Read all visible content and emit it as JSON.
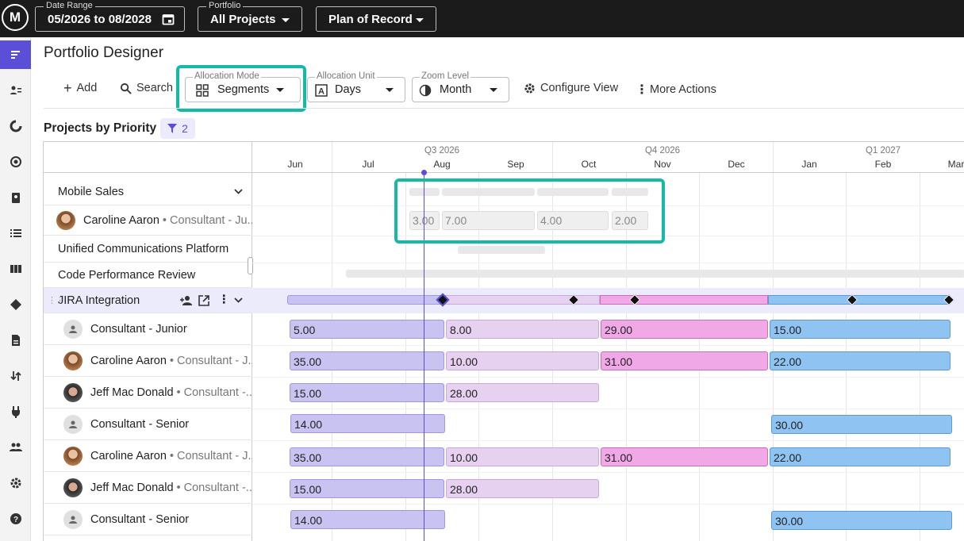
{
  "topbar": {
    "logo": "M",
    "date_range": {
      "label": "Date Range",
      "value": "05/2026 to 08/2028"
    },
    "portfolio": {
      "label": "Portfolio",
      "value": "All Projects"
    },
    "plan": {
      "value": "Plan of Record"
    }
  },
  "page": {
    "title": "Portfolio Designer"
  },
  "toolbar": {
    "add_label": "Add",
    "search_label": "Search",
    "allocation_mode": {
      "label": "Allocation Mode",
      "value": "Segments"
    },
    "allocation_unit": {
      "label": "Allocation Unit",
      "value": "Days"
    },
    "zoom_level": {
      "label": "Zoom Level",
      "value": "Month"
    },
    "configure_label": "Configure View",
    "more_label": "More Actions"
  },
  "section": {
    "title": "Projects by Priority",
    "filter_count": "2"
  },
  "timeline": {
    "quarters": [
      "Q3 2026",
      "Q4 2026",
      "Q1 2027"
    ],
    "months": [
      "Jun",
      "Jul",
      "Aug",
      "Sep",
      "Oct",
      "Nov",
      "Dec",
      "Jan",
      "Feb",
      "Mar"
    ]
  },
  "rows": [
    {
      "name": "Mobile Sales"
    },
    {
      "name": "Caroline Aaron",
      "role": "• Consultant - Ju..."
    },
    {
      "name": "Unified Communications Platform"
    },
    {
      "name": "Code Performance Review"
    },
    {
      "name": "JIRA Integration"
    },
    {
      "name": "Consultant - Junior"
    },
    {
      "name": "Caroline Aaron",
      "role": "• Consultant - J..."
    },
    {
      "name": "Jeff Mac Donald",
      "role": "• Consultant -..."
    },
    {
      "name": "Consultant - Senior"
    },
    {
      "name": "Caroline Aaron",
      "role": "• Consultant - J..."
    },
    {
      "name": "Jeff Mac Donald",
      "role": "• Consultant -..."
    },
    {
      "name": "Consultant - Senior"
    }
  ],
  "ghost_values": [
    "3.00",
    "7.00",
    "4.00",
    "2.00"
  ],
  "bars": {
    "r5": [
      "5.00",
      "8.00",
      "29.00",
      "15.00"
    ],
    "r6": [
      "35.00",
      "10.00",
      "31.00",
      "22.00"
    ],
    "r7": [
      "15.00",
      "28.00"
    ],
    "r8": [
      "14.00",
      "30.00"
    ],
    "r9": [
      "35.00",
      "10.00",
      "31.00",
      "22.00"
    ],
    "r10": [
      "15.00",
      "28.00"
    ],
    "r11": [
      "14.00",
      "30.00"
    ]
  },
  "colors": {
    "accent": "#5a4fd6",
    "highlight": "#16b9a8",
    "seg1": "#c8c3f1",
    "seg2": "#e6d1f0",
    "seg3": "#f1a8e6",
    "seg4": "#8ec3f2"
  }
}
